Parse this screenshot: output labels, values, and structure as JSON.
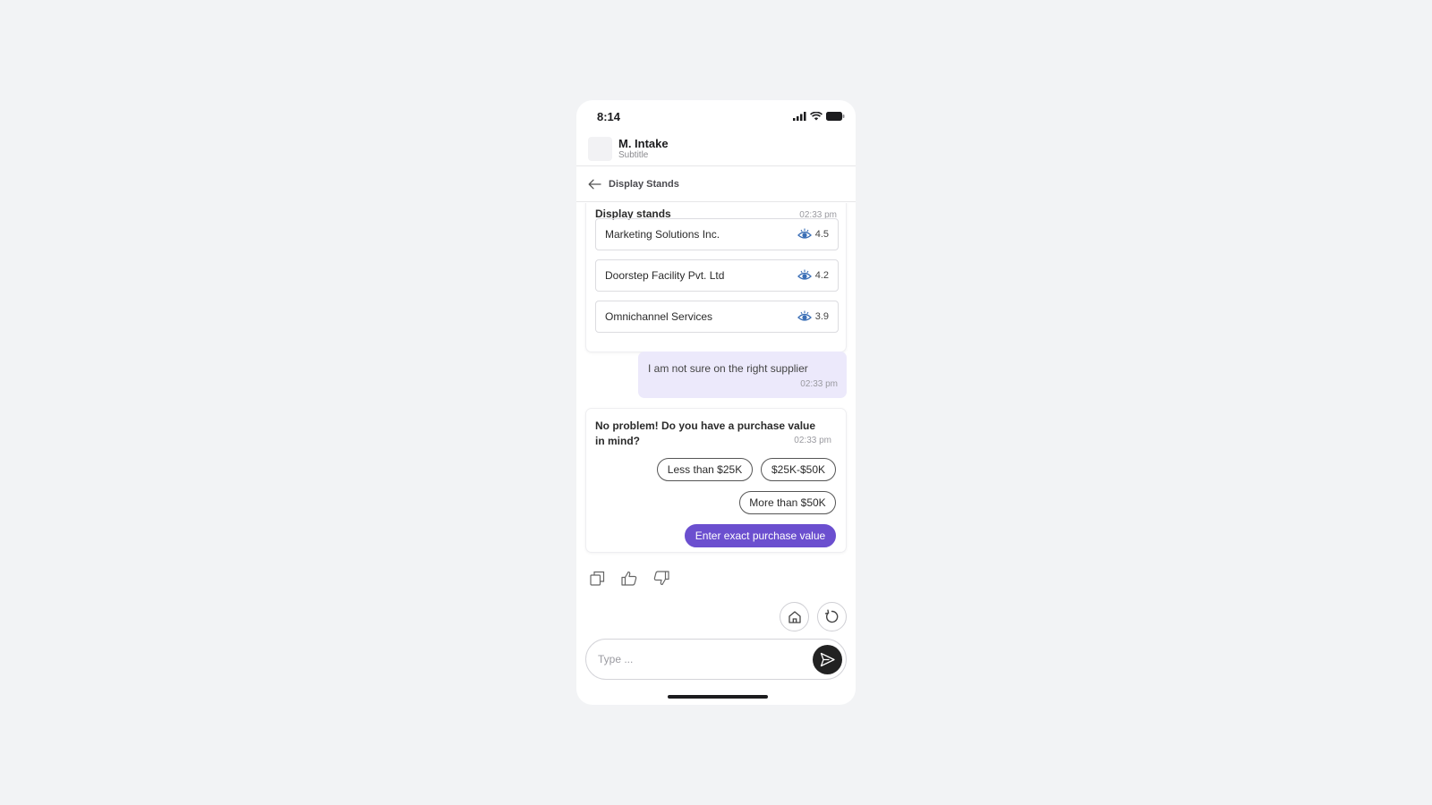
{
  "status_bar": {
    "time": "8:14",
    "icons": [
      "signal-icon",
      "wifi-icon",
      "battery-icon"
    ]
  },
  "header": {
    "title": "M. Intake",
    "subtitle": "Subtitle"
  },
  "nav": {
    "title": "Display Stands"
  },
  "supplier_card": {
    "title": "Display stands",
    "time": "02:33 pm",
    "suppliers": [
      {
        "name": "Marketing Solutions Inc.",
        "rating": "4.5"
      },
      {
        "name": "Doorstep Facility Pvt. Ltd",
        "rating": "4.2"
      },
      {
        "name": "Omnichannel Services",
        "rating": "3.9"
      }
    ]
  },
  "user_message": {
    "text": "I am not sure on the right supplier",
    "time": "02:33 pm"
  },
  "question_card": {
    "text": "No problem! Do you have a purchase value in mind?",
    "time": "02:33 pm",
    "options": [
      "Less than $25K",
      "$25K-$50K",
      "More than $50K"
    ],
    "primary_action": "Enter exact purchase value"
  },
  "composer": {
    "placeholder": "Type ..."
  },
  "colors": {
    "accent": "#6b4fcf",
    "user_bubble": "#ece9fb",
    "send_button": "#222222"
  }
}
